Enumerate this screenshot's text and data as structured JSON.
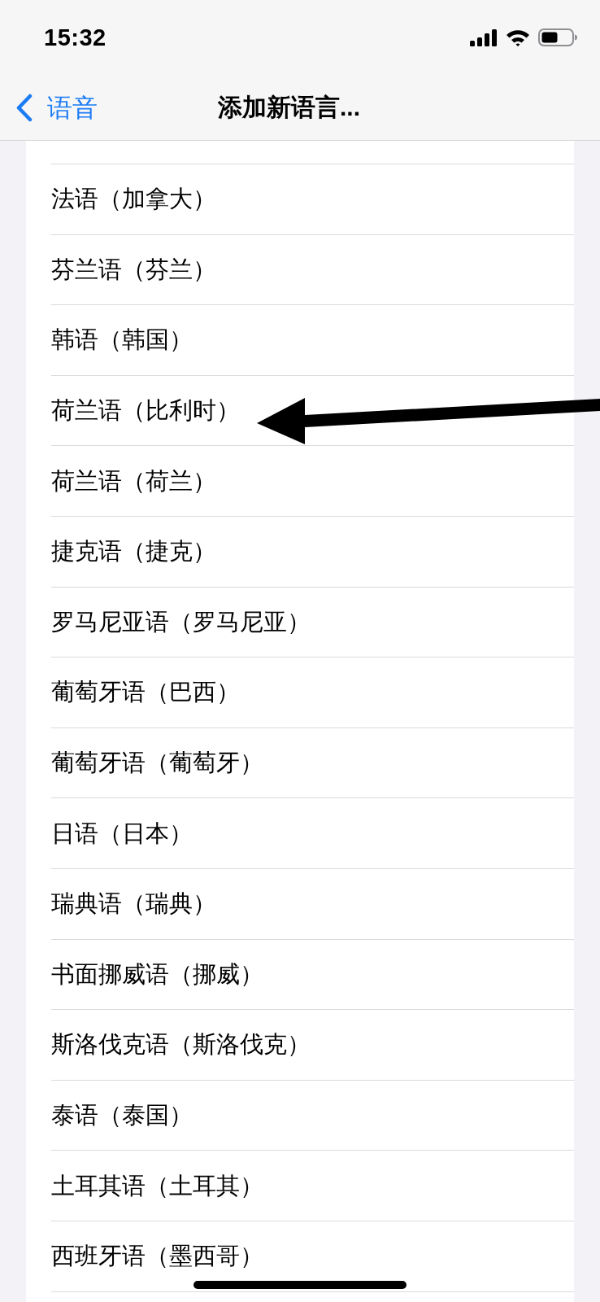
{
  "status_bar": {
    "time": "15:32"
  },
  "nav": {
    "back_label": "语音",
    "title": "添加新语言..."
  },
  "languages": [
    "法语（加拿大）",
    "芬兰语（芬兰）",
    "韩语（韩国）",
    "荷兰语（比利时）",
    "荷兰语（荷兰）",
    "捷克语（捷克）",
    "罗马尼亚语（罗马尼亚）",
    "葡萄牙语（巴西）",
    "葡萄牙语（葡萄牙）",
    "日语（日本）",
    "瑞典语（瑞典）",
    "书面挪威语（挪威）",
    "斯洛伐克语（斯洛伐克）",
    "泰语（泰国）",
    "土耳其语（土耳其）",
    "西班牙语（墨西哥）"
  ]
}
